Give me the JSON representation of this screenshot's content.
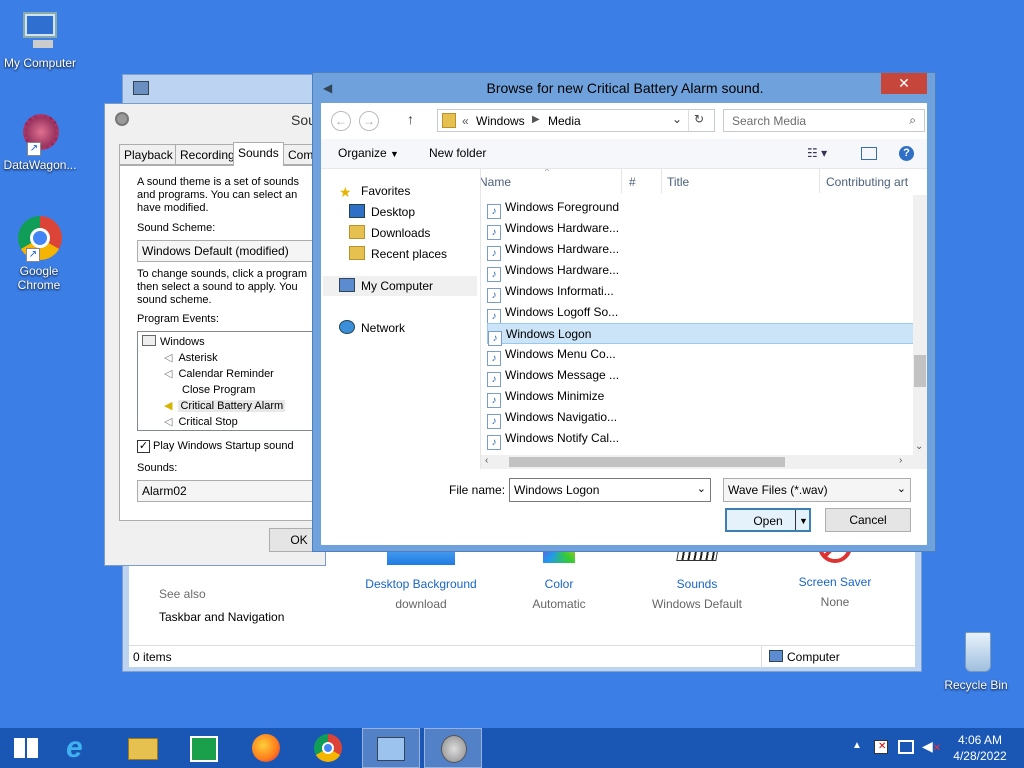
{
  "desktop": {
    "icons": [
      {
        "label": "My Computer"
      },
      {
        "label": "DataWagon..."
      },
      {
        "label": "Google Chrome"
      },
      {
        "label": "Recycle Bin"
      }
    ]
  },
  "personalization": {
    "see_also": "See also",
    "taskbar_link": "Taskbar and Navigation",
    "items": [
      {
        "label": "Desktop Background",
        "sub": "download"
      },
      {
        "label": "Color",
        "sub": "Automatic"
      },
      {
        "label": "Sounds",
        "sub": "Windows Default"
      },
      {
        "label": "Screen Saver",
        "sub": "None"
      }
    ],
    "status_items": "0 items",
    "status_computer": "Computer"
  },
  "sound_dialog": {
    "title": "Sou",
    "tabs": [
      "Playback",
      "Recording",
      "Sounds",
      "Comm"
    ],
    "theme_text": [
      "A sound theme is a set of sounds",
      "and programs.  You can select an",
      "have modified."
    ],
    "scheme_label": "Sound Scheme:",
    "scheme_value": "Windows Default (modified)",
    "change_text": [
      "To change sounds, click a program",
      "then select a sound to apply.  You",
      "sound scheme."
    ],
    "events_label": "Program Events:",
    "events": [
      {
        "label": "Windows"
      },
      {
        "label": "Asterisk"
      },
      {
        "label": "Calendar Reminder"
      },
      {
        "label": "Close Program"
      },
      {
        "label": "Critical Battery Alarm"
      },
      {
        "label": "Critical Stop"
      }
    ],
    "startup_label": "Play Windows Startup sound",
    "sounds_label": "Sounds:",
    "sounds_value": "Alarm02",
    "ok_label": "OK"
  },
  "browse": {
    "title": "Browse for new Critical Battery Alarm sound.",
    "close_glyph": "✕",
    "breadcrumb": [
      "«",
      "Windows",
      "Media"
    ],
    "search_placeholder": "Search Media",
    "organize_label": "Organize",
    "new_folder_label": "New folder",
    "nav": [
      {
        "label": "Favorites"
      },
      {
        "label": "Desktop"
      },
      {
        "label": "Downloads"
      },
      {
        "label": "Recent places"
      },
      {
        "label": "My Computer"
      },
      {
        "label": "Network"
      }
    ],
    "columns": [
      "Name",
      "#",
      "Title",
      "Contributing art"
    ],
    "files": [
      {
        "name": "Windows Foreground"
      },
      {
        "name": "Windows Hardware..."
      },
      {
        "name": "Windows Hardware..."
      },
      {
        "name": "Windows Hardware..."
      },
      {
        "name": "Windows Informati..."
      },
      {
        "name": "Windows Logoff So..."
      },
      {
        "name": "Windows Logon",
        "selected": true
      },
      {
        "name": "Windows Menu Co..."
      },
      {
        "name": "Windows Message ..."
      },
      {
        "name": "Windows Minimize"
      },
      {
        "name": "Windows Navigatio..."
      },
      {
        "name": "Windows Notify Cal..."
      }
    ],
    "filename_label": "File name:",
    "filename_value": "Windows Logon",
    "filter_value": "Wave Files (*.wav)",
    "open_label": "Open",
    "cancel_label": "Cancel"
  },
  "taskbar": {
    "time": "4:06 AM",
    "date": "4/28/2022"
  },
  "colors": {
    "desktop": "#3b7ee6",
    "taskbar": "#1a57b5",
    "close_button": "#c7463b",
    "link": "#1a64c8",
    "selection": "#cce4f7"
  }
}
